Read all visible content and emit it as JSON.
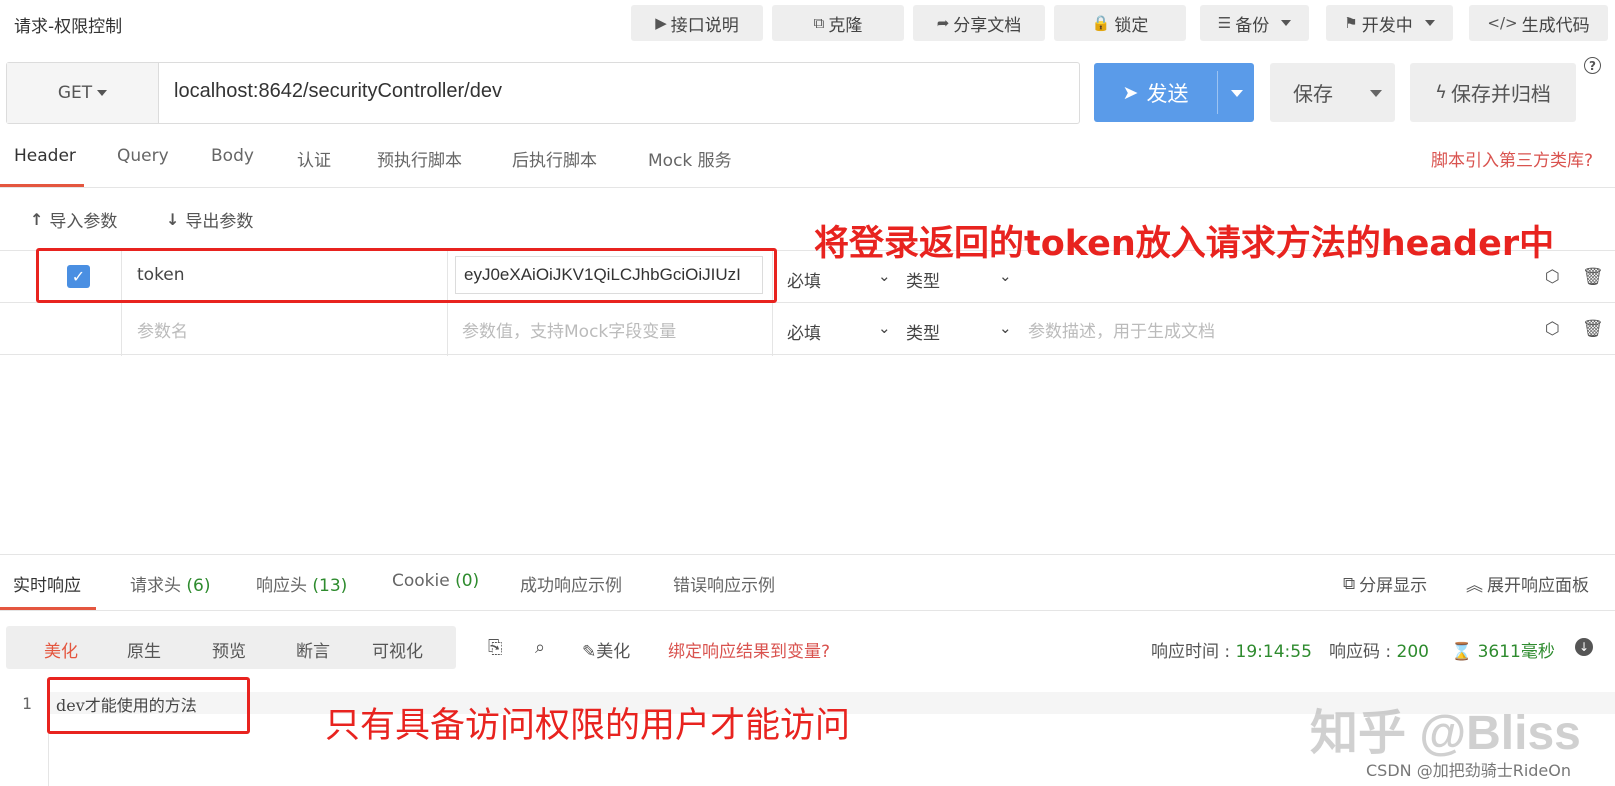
{
  "header": {
    "title": "请求-权限控制"
  },
  "top_buttons": [
    {
      "icon": "play-icon",
      "glyph": "▶",
      "label": "接口说明"
    },
    {
      "icon": "copy-icon",
      "glyph": "⧉",
      "label": "克隆"
    },
    {
      "icon": "share-icon",
      "glyph": "➦",
      "label": "分享文档"
    },
    {
      "icon": "lock-icon",
      "glyph": "🔒",
      "label": "锁定"
    },
    {
      "icon": "database-icon",
      "glyph": "☰",
      "label": "备份"
    },
    {
      "icon": "flag-icon",
      "glyph": "⚑",
      "label": "开发中"
    },
    {
      "icon": "code-icon",
      "glyph": "</>",
      "label": "生成代码"
    }
  ],
  "request": {
    "method": "GET",
    "url": "localhost:8642/securityController/dev",
    "send_label": "发送",
    "save_label": "保存",
    "save_archive_label": "保存并归档",
    "help": "?"
  },
  "req_tabs": [
    "Header",
    "Query",
    "Body",
    "认证",
    "预执行脚本",
    "后执行脚本",
    "Mock 服务"
  ],
  "third_party_link": "脚本引入第三方类库?",
  "param_tools": {
    "import": "导入参数",
    "export": "导出参数"
  },
  "params": [
    {
      "name": "token",
      "value": "eyJ0eXAiOiJKV1QiLCJhbGciOiJIUzI",
      "required": "必填",
      "type": "类型",
      "description": ""
    },
    {
      "name_placeholder": "参数名",
      "value_placeholder": "参数值，支持Mock字段变量",
      "required": "必填",
      "type": "类型",
      "description_placeholder": "参数描述，用于生成文档"
    }
  ],
  "annotations": {
    "header_note": "将登录返回的token放入请求方法的header中",
    "response_note": "只有具备访问权限的用户才能访问"
  },
  "resp_tabs": {
    "realtime": "实时响应",
    "req_headers": "请求头",
    "req_headers_count": "(6)",
    "resp_headers": "响应头",
    "resp_headers_count": "(13)",
    "cookie": "Cookie",
    "cookie_count": "(0)",
    "success_example": "成功响应示例",
    "error_example": "错误响应示例",
    "split_view": "分屏显示",
    "expand_panel": "展开响应面板"
  },
  "view_modes": [
    "美化",
    "原生",
    "预览",
    "断言",
    "可视化"
  ],
  "toolbar": {
    "beautify": "美化",
    "bind_result": "绑定响应结果到变量?"
  },
  "meta": {
    "time_label": "响应时间 : ",
    "time_value": "19:14:55",
    "code_label": "响应码 : ",
    "code_value": "200",
    "duration_value": "3611毫秒"
  },
  "editor": {
    "line": "1",
    "content": "dev才能使用的方法"
  },
  "watermark": "知乎 @Bliss",
  "csdn": "CSDN @加把劲骑士RideOn",
  "colors": {
    "accent": "#e4563f",
    "primary": "#5a9be9",
    "success": "#2e8b2e",
    "annotation": "#e8231f"
  }
}
